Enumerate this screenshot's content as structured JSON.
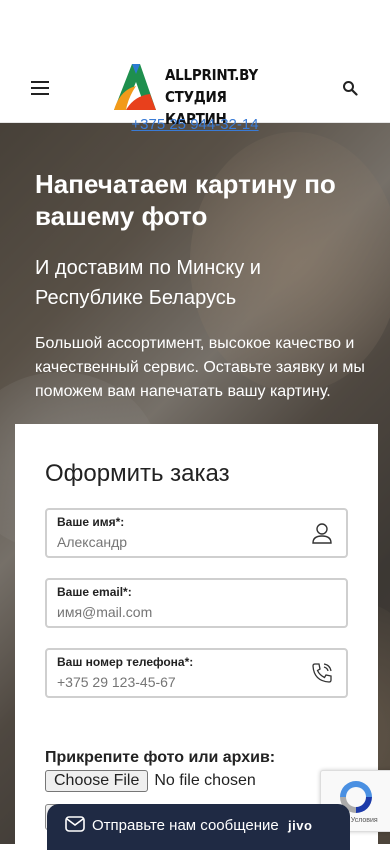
{
  "header": {
    "menu_icon": "hamburger-menu-icon",
    "logo_line1": "ALLPRINT.BY",
    "logo_line2": "СТУДИЯ КАРТИН",
    "search_icon": "search-icon"
  },
  "hero": {
    "phone": "+375 25 944-32-14",
    "title": "Напечатаем картину по вашему фото",
    "subtitle": "И доставим по Минску и Республике Беларусь",
    "description": "Большой ассортимент, высокое качество и качественный сервис. Оставьте заявку и мы поможем вам напечатать вашу картину."
  },
  "form": {
    "title": "Оформить заказ",
    "name_label": "Ваше имя*:",
    "name_placeholder": "Александр",
    "email_label": "Ваше email*:",
    "email_placeholder": "имя@mail.com",
    "phone_label": "Ваш номер телефона*:",
    "phone_placeholder": "+375 29 123-45-67",
    "attach_label": "Прикрепите фото или архив:",
    "file_button": "Choose File",
    "file_status": "No file chosen"
  },
  "chat": {
    "text": "Отправьте нам сообщение",
    "brand": "jivo"
  },
  "colors": {
    "link": "#3a7bd5",
    "chat_bg": "#1f2a44"
  }
}
